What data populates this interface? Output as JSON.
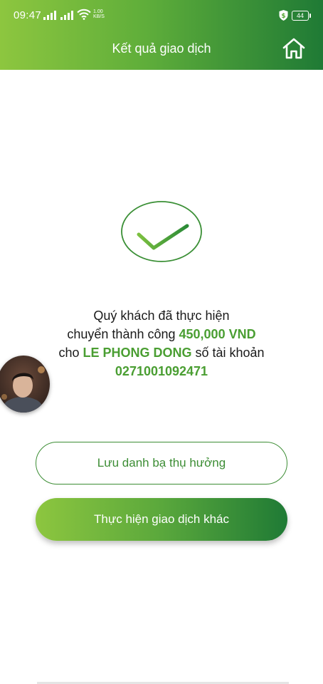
{
  "status_bar": {
    "time": "09:47",
    "net_speed_value": "1.00",
    "net_speed_unit": "KB/S",
    "battery": "44",
    "icons": [
      "signal-icon",
      "signal-icon",
      "wifi-icon",
      "shield-icon",
      "battery-icon"
    ]
  },
  "header": {
    "title": "Kết quả giao dịch",
    "home_icon": "home-icon"
  },
  "result": {
    "icon": "check-circle-icon",
    "line1": "Quý khách đã thực hiện",
    "line2_prefix": "chuyển thành công ",
    "amount": "450,000 VND",
    "line3_prefix": "cho ",
    "recipient_name": "LE PHONG DONG",
    "line3_suffix": " số tài khoản",
    "account_number": "0271001092471"
  },
  "actions": {
    "save_beneficiary_label": "Lưu danh bạ thụ hưởng",
    "new_transaction_label": "Thực hiện giao dịch khác"
  },
  "colors": {
    "gradient_start": "#8dc63f",
    "gradient_end": "#1f7a35",
    "accent_text": "#4a9e32"
  }
}
